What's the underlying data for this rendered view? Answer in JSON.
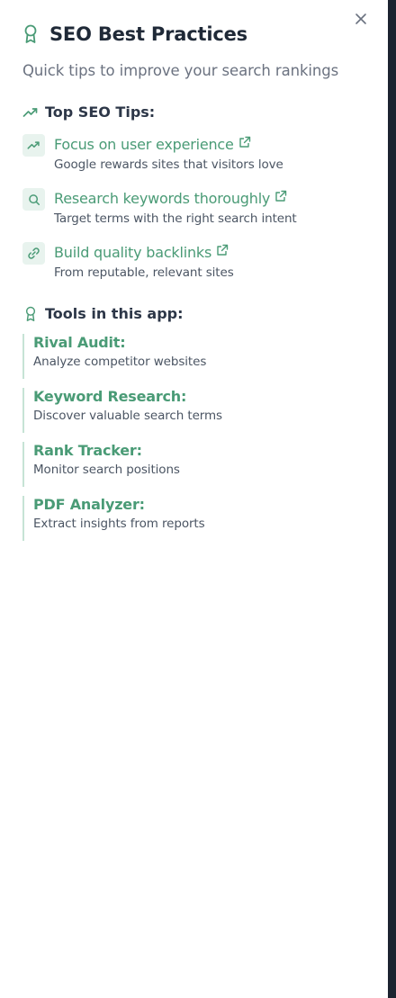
{
  "header": {
    "title": "SEO Best Practices",
    "subtitle": "Quick tips to improve your search rankings",
    "title_icon": "award-icon",
    "close_icon": "close-icon"
  },
  "tips_section": {
    "heading": "Top SEO Tips:",
    "icon": "trending-up-icon",
    "items": [
      {
        "title": "Focus on user experience",
        "description": "Google rewards sites that visitors love",
        "icon": "trending-up-icon"
      },
      {
        "title": "Research keywords thoroughly",
        "description": "Target terms with the right search intent",
        "icon": "search-icon"
      },
      {
        "title": "Build quality backlinks",
        "description": "From reputable, relevant sites",
        "icon": "link-icon"
      }
    ]
  },
  "tools_section": {
    "heading": "Tools in this app:",
    "icon": "award-icon",
    "items": [
      {
        "name": "Rival Audit:",
        "description": "Analyze competitor websites"
      },
      {
        "name": "Keyword Research:",
        "description": "Discover valuable search terms"
      },
      {
        "name": "Rank Tracker:",
        "description": "Monitor search positions"
      },
      {
        "name": "PDF Analyzer:",
        "description": "Extract insights from reports"
      }
    ]
  },
  "colors": {
    "accent": "#4a9b76",
    "accent_light": "#e8f3ee",
    "heading": "#1f2937",
    "muted": "#6b7280",
    "edge": "#1c2330"
  }
}
